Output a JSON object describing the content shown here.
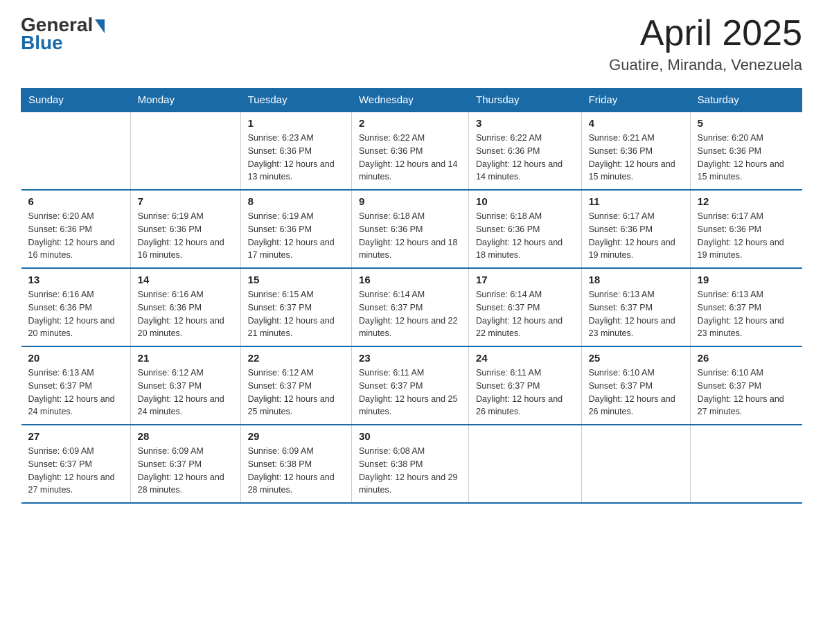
{
  "logo": {
    "general": "General",
    "blue": "Blue",
    "arrow_color": "#1a6aa8"
  },
  "header": {
    "month_title": "April 2025",
    "location": "Guatire, Miranda, Venezuela"
  },
  "weekdays": [
    "Sunday",
    "Monday",
    "Tuesday",
    "Wednesday",
    "Thursday",
    "Friday",
    "Saturday"
  ],
  "weeks": [
    [
      {
        "day": "",
        "sunrise": "",
        "sunset": "",
        "daylight": ""
      },
      {
        "day": "",
        "sunrise": "",
        "sunset": "",
        "daylight": ""
      },
      {
        "day": "1",
        "sunrise": "Sunrise: 6:23 AM",
        "sunset": "Sunset: 6:36 PM",
        "daylight": "Daylight: 12 hours and 13 minutes."
      },
      {
        "day": "2",
        "sunrise": "Sunrise: 6:22 AM",
        "sunset": "Sunset: 6:36 PM",
        "daylight": "Daylight: 12 hours and 14 minutes."
      },
      {
        "day": "3",
        "sunrise": "Sunrise: 6:22 AM",
        "sunset": "Sunset: 6:36 PM",
        "daylight": "Daylight: 12 hours and 14 minutes."
      },
      {
        "day": "4",
        "sunrise": "Sunrise: 6:21 AM",
        "sunset": "Sunset: 6:36 PM",
        "daylight": "Daylight: 12 hours and 15 minutes."
      },
      {
        "day": "5",
        "sunrise": "Sunrise: 6:20 AM",
        "sunset": "Sunset: 6:36 PM",
        "daylight": "Daylight: 12 hours and 15 minutes."
      }
    ],
    [
      {
        "day": "6",
        "sunrise": "Sunrise: 6:20 AM",
        "sunset": "Sunset: 6:36 PM",
        "daylight": "Daylight: 12 hours and 16 minutes."
      },
      {
        "day": "7",
        "sunrise": "Sunrise: 6:19 AM",
        "sunset": "Sunset: 6:36 PM",
        "daylight": "Daylight: 12 hours and 16 minutes."
      },
      {
        "day": "8",
        "sunrise": "Sunrise: 6:19 AM",
        "sunset": "Sunset: 6:36 PM",
        "daylight": "Daylight: 12 hours and 17 minutes."
      },
      {
        "day": "9",
        "sunrise": "Sunrise: 6:18 AM",
        "sunset": "Sunset: 6:36 PM",
        "daylight": "Daylight: 12 hours and 18 minutes."
      },
      {
        "day": "10",
        "sunrise": "Sunrise: 6:18 AM",
        "sunset": "Sunset: 6:36 PM",
        "daylight": "Daylight: 12 hours and 18 minutes."
      },
      {
        "day": "11",
        "sunrise": "Sunrise: 6:17 AM",
        "sunset": "Sunset: 6:36 PM",
        "daylight": "Daylight: 12 hours and 19 minutes."
      },
      {
        "day": "12",
        "sunrise": "Sunrise: 6:17 AM",
        "sunset": "Sunset: 6:36 PM",
        "daylight": "Daylight: 12 hours and 19 minutes."
      }
    ],
    [
      {
        "day": "13",
        "sunrise": "Sunrise: 6:16 AM",
        "sunset": "Sunset: 6:36 PM",
        "daylight": "Daylight: 12 hours and 20 minutes."
      },
      {
        "day": "14",
        "sunrise": "Sunrise: 6:16 AM",
        "sunset": "Sunset: 6:36 PM",
        "daylight": "Daylight: 12 hours and 20 minutes."
      },
      {
        "day": "15",
        "sunrise": "Sunrise: 6:15 AM",
        "sunset": "Sunset: 6:37 PM",
        "daylight": "Daylight: 12 hours and 21 minutes."
      },
      {
        "day": "16",
        "sunrise": "Sunrise: 6:14 AM",
        "sunset": "Sunset: 6:37 PM",
        "daylight": "Daylight: 12 hours and 22 minutes."
      },
      {
        "day": "17",
        "sunrise": "Sunrise: 6:14 AM",
        "sunset": "Sunset: 6:37 PM",
        "daylight": "Daylight: 12 hours and 22 minutes."
      },
      {
        "day": "18",
        "sunrise": "Sunrise: 6:13 AM",
        "sunset": "Sunset: 6:37 PM",
        "daylight": "Daylight: 12 hours and 23 minutes."
      },
      {
        "day": "19",
        "sunrise": "Sunrise: 6:13 AM",
        "sunset": "Sunset: 6:37 PM",
        "daylight": "Daylight: 12 hours and 23 minutes."
      }
    ],
    [
      {
        "day": "20",
        "sunrise": "Sunrise: 6:13 AM",
        "sunset": "Sunset: 6:37 PM",
        "daylight": "Daylight: 12 hours and 24 minutes."
      },
      {
        "day": "21",
        "sunrise": "Sunrise: 6:12 AM",
        "sunset": "Sunset: 6:37 PM",
        "daylight": "Daylight: 12 hours and 24 minutes."
      },
      {
        "day": "22",
        "sunrise": "Sunrise: 6:12 AM",
        "sunset": "Sunset: 6:37 PM",
        "daylight": "Daylight: 12 hours and 25 minutes."
      },
      {
        "day": "23",
        "sunrise": "Sunrise: 6:11 AM",
        "sunset": "Sunset: 6:37 PM",
        "daylight": "Daylight: 12 hours and 25 minutes."
      },
      {
        "day": "24",
        "sunrise": "Sunrise: 6:11 AM",
        "sunset": "Sunset: 6:37 PM",
        "daylight": "Daylight: 12 hours and 26 minutes."
      },
      {
        "day": "25",
        "sunrise": "Sunrise: 6:10 AM",
        "sunset": "Sunset: 6:37 PM",
        "daylight": "Daylight: 12 hours and 26 minutes."
      },
      {
        "day": "26",
        "sunrise": "Sunrise: 6:10 AM",
        "sunset": "Sunset: 6:37 PM",
        "daylight": "Daylight: 12 hours and 27 minutes."
      }
    ],
    [
      {
        "day": "27",
        "sunrise": "Sunrise: 6:09 AM",
        "sunset": "Sunset: 6:37 PM",
        "daylight": "Daylight: 12 hours and 27 minutes."
      },
      {
        "day": "28",
        "sunrise": "Sunrise: 6:09 AM",
        "sunset": "Sunset: 6:37 PM",
        "daylight": "Daylight: 12 hours and 28 minutes."
      },
      {
        "day": "29",
        "sunrise": "Sunrise: 6:09 AM",
        "sunset": "Sunset: 6:38 PM",
        "daylight": "Daylight: 12 hours and 28 minutes."
      },
      {
        "day": "30",
        "sunrise": "Sunrise: 6:08 AM",
        "sunset": "Sunset: 6:38 PM",
        "daylight": "Daylight: 12 hours and 29 minutes."
      },
      {
        "day": "",
        "sunrise": "",
        "sunset": "",
        "daylight": ""
      },
      {
        "day": "",
        "sunrise": "",
        "sunset": "",
        "daylight": ""
      },
      {
        "day": "",
        "sunrise": "",
        "sunset": "",
        "daylight": ""
      }
    ]
  ]
}
